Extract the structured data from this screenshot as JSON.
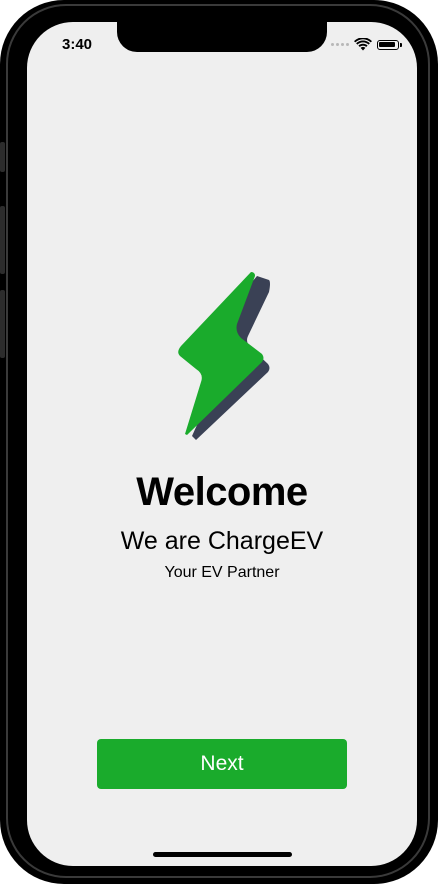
{
  "status_bar": {
    "time": "3:40"
  },
  "icons": {
    "logo": "lightning-bolt-icon",
    "wifi": "wifi-icon",
    "battery": "battery-icon",
    "signal": "cellular-signal-icon"
  },
  "welcome": {
    "title": "Welcome",
    "tagline": "We are ChargeEV",
    "subtitle": "Your EV Partner"
  },
  "actions": {
    "next_label": "Next"
  },
  "colors": {
    "brand_green": "#1aab2c",
    "logo_shadow": "#3a4155",
    "background": "#efefef"
  }
}
